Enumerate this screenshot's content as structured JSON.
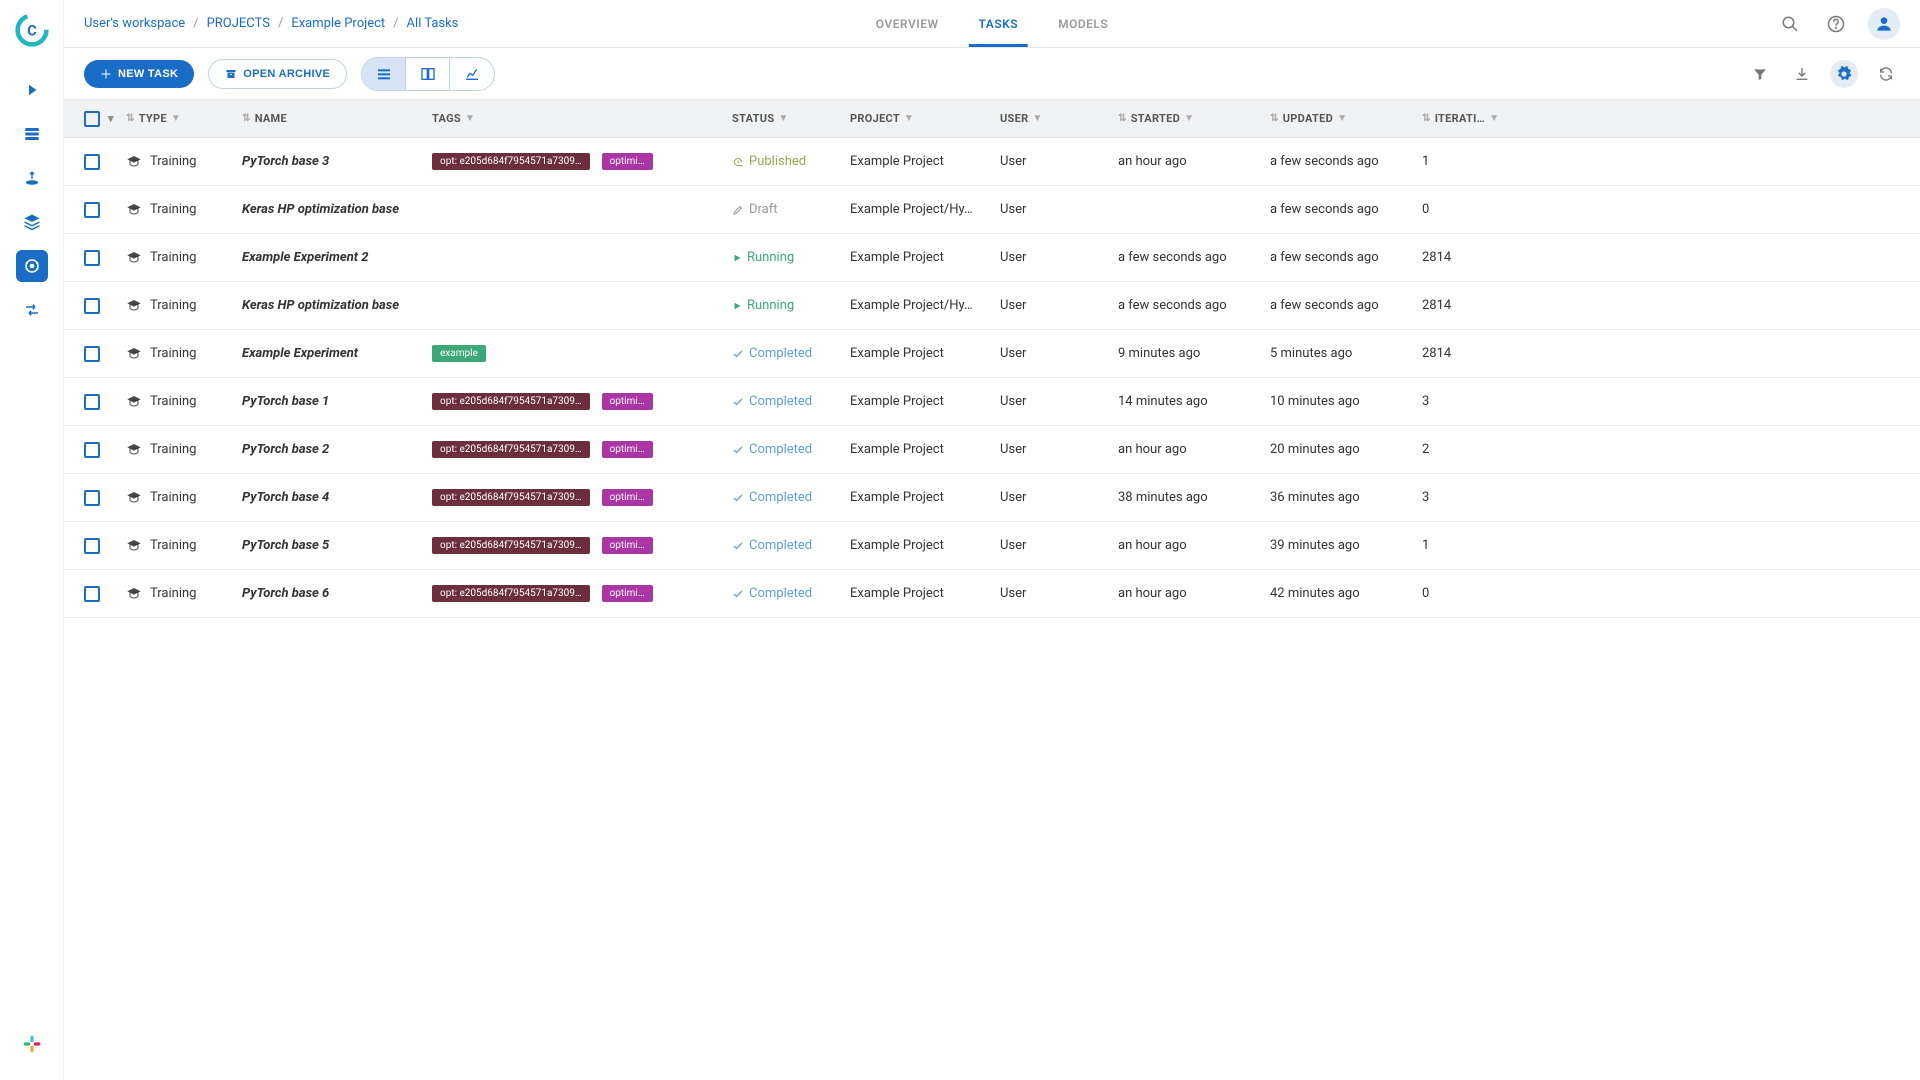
{
  "breadcrumb": {
    "workspace": "User's workspace",
    "projects": "PROJECTS",
    "project": "Example Project",
    "current": "All Tasks"
  },
  "tabs": {
    "overview": "OVERVIEW",
    "tasks": "TASKS",
    "models": "MODELS"
  },
  "toolbar": {
    "new_task": "NEW TASK",
    "open_archive": "OPEN ARCHIVE"
  },
  "columns": {
    "type": "TYPE",
    "name": "NAME",
    "tags": "TAGS",
    "status": "STATUS",
    "project": "PROJECT",
    "user": "USER",
    "started": "STARTED",
    "updated": "UPDATED",
    "iterations": "ITERATI…"
  },
  "status_labels": {
    "published": "Published",
    "draft": "Draft",
    "running": "Running",
    "completed": "Completed"
  },
  "rows": [
    {
      "type": "Training",
      "name": "PyTorch base 3",
      "tags": [
        {
          "text": "opt: e205d684f7954571a7309…",
          "kind": "dark"
        },
        {
          "text": "optimi…",
          "kind": "purple"
        }
      ],
      "status": "published",
      "project": "Example Project",
      "user": "User",
      "started": "an hour ago",
      "updated": "a few seconds ago",
      "iterations": "1"
    },
    {
      "type": "Training",
      "name": "Keras HP optimization base",
      "tags": [],
      "status": "draft",
      "project": "Example Project/Hy…",
      "user": "User",
      "started": "",
      "updated": "a few seconds ago",
      "iterations": "0"
    },
    {
      "type": "Training",
      "name": "Example Experiment 2",
      "tags": [],
      "status": "running",
      "project": "Example Project",
      "user": "User",
      "started": "a few seconds ago",
      "updated": "a few seconds ago",
      "iterations": "2814"
    },
    {
      "type": "Training",
      "name": "Keras HP optimization base",
      "tags": [],
      "status": "running",
      "project": "Example Project/Hy…",
      "user": "User",
      "started": "a few seconds ago",
      "updated": "a few seconds ago",
      "iterations": "2814"
    },
    {
      "type": "Training",
      "name": "Example Experiment",
      "tags": [
        {
          "text": "example",
          "kind": "green"
        }
      ],
      "status": "completed",
      "project": "Example Project",
      "user": "User",
      "started": "9 minutes ago",
      "updated": "5 minutes ago",
      "iterations": "2814"
    },
    {
      "type": "Training",
      "name": "PyTorch base 1",
      "tags": [
        {
          "text": "opt: e205d684f7954571a7309…",
          "kind": "dark"
        },
        {
          "text": "optimi…",
          "kind": "purple"
        }
      ],
      "status": "completed",
      "project": "Example Project",
      "user": "User",
      "started": "14 minutes ago",
      "updated": "10 minutes ago",
      "iterations": "3"
    },
    {
      "type": "Training",
      "name": "PyTorch base 2",
      "tags": [
        {
          "text": "opt: e205d684f7954571a7309…",
          "kind": "dark"
        },
        {
          "text": "optimi…",
          "kind": "purple"
        }
      ],
      "status": "completed",
      "project": "Example Project",
      "user": "User",
      "started": "an hour ago",
      "updated": "20 minutes ago",
      "iterations": "2"
    },
    {
      "type": "Training",
      "name": "PyTorch base 4",
      "tags": [
        {
          "text": "opt: e205d684f7954571a7309…",
          "kind": "dark"
        },
        {
          "text": "optimi…",
          "kind": "purple"
        }
      ],
      "status": "completed",
      "project": "Example Project",
      "user": "User",
      "started": "38 minutes ago",
      "updated": "36 minutes ago",
      "iterations": "3"
    },
    {
      "type": "Training",
      "name": "PyTorch base 5",
      "tags": [
        {
          "text": "opt: e205d684f7954571a7309…",
          "kind": "dark"
        },
        {
          "text": "optimi…",
          "kind": "purple"
        }
      ],
      "status": "completed",
      "project": "Example Project",
      "user": "User",
      "started": "an hour ago",
      "updated": "39 minutes ago",
      "iterations": "1"
    },
    {
      "type": "Training",
      "name": "PyTorch base 6",
      "tags": [
        {
          "text": "opt: e205d684f7954571a7309…",
          "kind": "dark"
        },
        {
          "text": "optimi…",
          "kind": "purple"
        }
      ],
      "status": "completed",
      "project": "Example Project",
      "user": "User",
      "started": "an hour ago",
      "updated": "42 minutes ago",
      "iterations": "0"
    }
  ]
}
